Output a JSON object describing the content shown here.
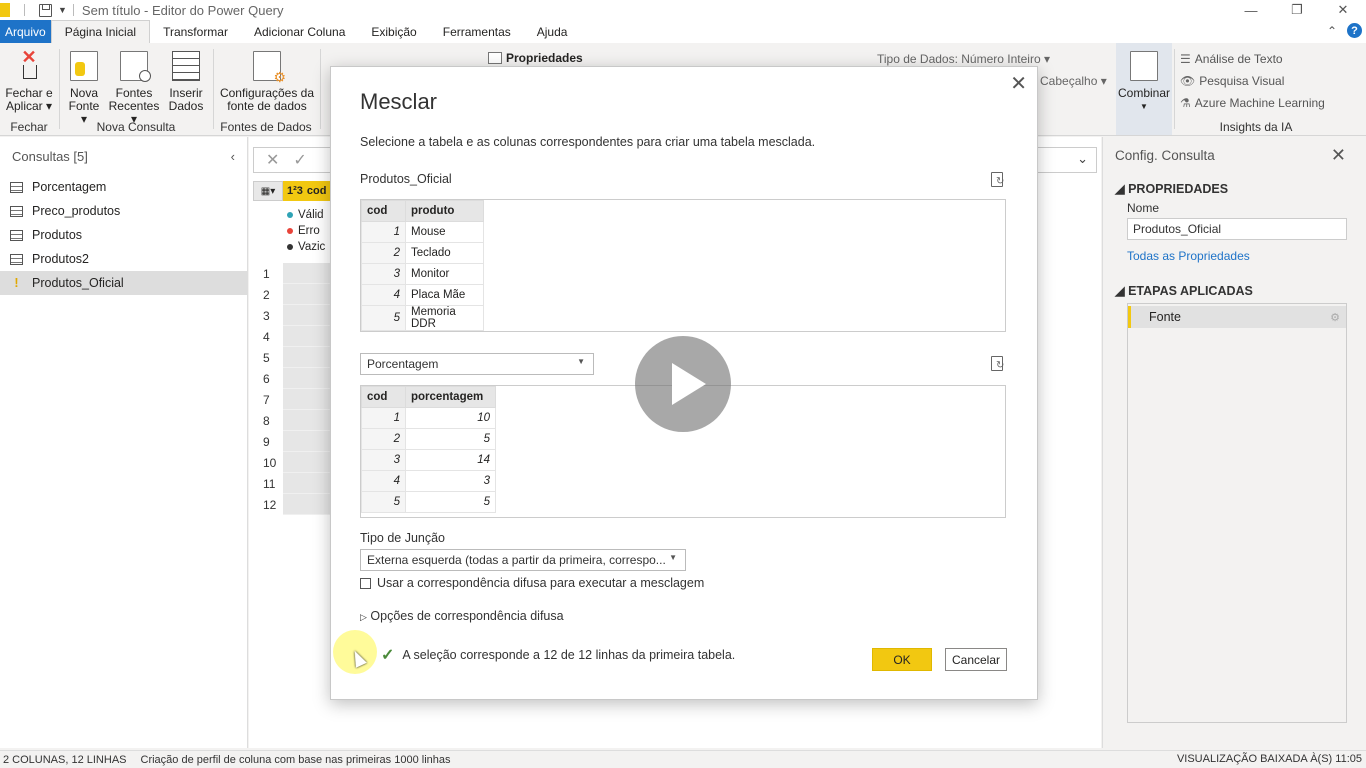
{
  "window": {
    "title": "Sem título - Editor do Power Query",
    "minimize": "—",
    "restore": "❐",
    "close": "✕"
  },
  "ribbon_tabs": [
    {
      "label": "Arquivo"
    },
    {
      "label": "Página Inicial"
    },
    {
      "label": "Transformar"
    },
    {
      "label": "Adicionar Coluna"
    },
    {
      "label": "Exibição"
    },
    {
      "label": "Ferramentas"
    },
    {
      "label": "Ajuda"
    }
  ],
  "ribbon": {
    "fechar_aplicar": "Fechar e Aplicar ▾",
    "nova_fonte": "Nova Fonte ▾",
    "fontes_recentes": "Fontes Recentes ▾",
    "inserir_dados": "Inserir Dados",
    "config_fonte": "Configurações da fonte de dados",
    "propriedades": "Propriedades",
    "tipo_dados": "Tipo de Dados: Número Inteiro ▾",
    "cabecalho": "Cabeçalho ▾",
    "combinar": "Combinar",
    "analise_texto": "Análise de Texto",
    "pesquisa_visual": "Pesquisa Visual",
    "azure_ml": "Azure Machine Learning",
    "groups": {
      "fechar": "Fechar",
      "nova_consulta": "Nova Consulta",
      "fontes_dados": "Fontes de Dados",
      "insights": "Insights da IA"
    }
  },
  "queries_panel": {
    "title": "Consultas [5]",
    "items": [
      {
        "label": "Porcentagem"
      },
      {
        "label": "Preco_produtos"
      },
      {
        "label": "Produtos"
      },
      {
        "label": "Produtos2"
      },
      {
        "label": "Produtos_Oficial"
      }
    ]
  },
  "grid": {
    "column_header": "cod",
    "type_badge": "1²3",
    "quality": [
      "Válid",
      "Erro",
      "Vazic"
    ],
    "rows": [
      "1",
      "2",
      "3",
      "4",
      "5",
      "6",
      "7",
      "8",
      "9",
      "10",
      "11",
      "12"
    ]
  },
  "settings_panel": {
    "title": "Config. Consulta",
    "properties_heading": "PROPRIEDADES",
    "name_label": "Nome",
    "name_value": "Produtos_Oficial",
    "all_properties": "Todas as Propriedades",
    "steps_heading": "ETAPAS APLICADAS",
    "steps": [
      {
        "label": "Fonte"
      }
    ]
  },
  "dialog": {
    "title": "Mesclar",
    "subtitle": "Selecione a tabela e as colunas correspondentes para criar uma tabela mesclada.",
    "first_table_name": "Produtos_Oficial",
    "first_table": {
      "headers": [
        "cod",
        "produto"
      ],
      "rows": [
        [
          "1",
          "Mouse"
        ],
        [
          "2",
          "Teclado"
        ],
        [
          "3",
          "Monitor"
        ],
        [
          "4",
          "Placa Mãe"
        ],
        [
          "5",
          "Memoria DDR"
        ]
      ]
    },
    "second_table_select": "Porcentagem",
    "second_table": {
      "headers": [
        "cod",
        "porcentagem"
      ],
      "rows": [
        [
          "1",
          "10"
        ],
        [
          "2",
          "5"
        ],
        [
          "3",
          "14"
        ],
        [
          "4",
          "3"
        ],
        [
          "5",
          "5"
        ]
      ]
    },
    "join_type_label": "Tipo de Junção",
    "join_type_value": "Externa esquerda (todas a partir da primeira, correspo...",
    "fuzzy_checkbox_label": "Usar a correspondência difusa para executar a mesclagem",
    "fuzzy_options": "Opções de correspondência difusa",
    "status": "A seleção corresponde a 12 de 12 linhas da primeira tabela.",
    "ok": "OK",
    "cancel": "Cancelar"
  },
  "statusbar": {
    "columns_rows": "2 COLUNAS, 12 LINHAS",
    "profiling": "Criação de perfil de coluna com base nas primeiras 1000 linhas",
    "preview": "VISUALIZAÇÃO BAIXADA À(S) 11:05"
  }
}
